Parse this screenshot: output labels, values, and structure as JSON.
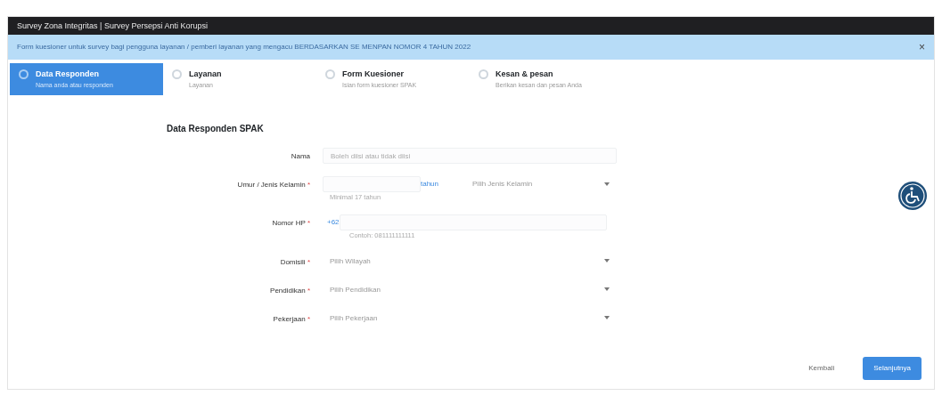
{
  "window": {
    "title": "Survey Zona Integritas | Survey Persepsi Anti Korupsi"
  },
  "alert": {
    "text": "Form kuesioner untuk survey bagi pengguna layanan / pemberi layanan yang mengacu BERDASARKAN SE MENPAN NOMOR 4 TAHUN 2022",
    "close": "×"
  },
  "steps": [
    {
      "title": "Data Responden",
      "subtitle": "Nama anda atau responden",
      "selected": true
    },
    {
      "title": "Layanan",
      "subtitle": "Layanan",
      "selected": false
    },
    {
      "title": "Form Kuesioner",
      "subtitle": "Isian form kuesioner SPAK",
      "selected": false
    },
    {
      "title": "Kesan & pesan",
      "subtitle": "Berikan kesan dan pesan Anda",
      "selected": false
    }
  ],
  "form": {
    "heading": "Data Responden SPAK",
    "fields": [
      {
        "kind": "text",
        "label": "Nama",
        "placeholder": "Boleh diisi atau tidak diisi"
      },
      {
        "kind": "age",
        "label": "Umur / Jenis Kelamin",
        "required_mark": "*",
        "addon": "tahun",
        "hint": "Minimal 17 tahun",
        "select": "Pilih Jenis Kelamin"
      },
      {
        "kind": "phone",
        "label": "Nomor HP",
        "required_mark": "*",
        "prefix": "+62",
        "hint": "Contoh: 081111111111"
      },
      {
        "kind": "select",
        "label": "Domisili",
        "required_mark": "*",
        "select": "Pilih Wilayah"
      },
      {
        "kind": "select",
        "label": "Pendidikan",
        "required_mark": "*",
        "select": "Pilih Pendidikan"
      },
      {
        "kind": "select",
        "label": "Pekerjaan",
        "required_mark": "*",
        "select": "Pilih Pekerjaan"
      }
    ]
  },
  "buttons": {
    "back": "Kembali",
    "next": "Selanjutnya"
  }
}
